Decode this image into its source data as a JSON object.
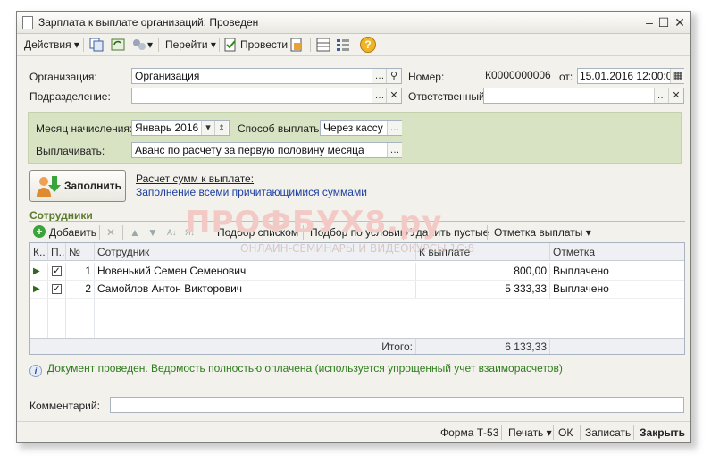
{
  "window": {
    "title": "Зарплата к выплате организаций: Проведен"
  },
  "toolbar": {
    "actions_label": "Действия",
    "goto_label": "Перейти",
    "post_label": "Провести",
    "help_icon": "?"
  },
  "form": {
    "org_label": "Организация:",
    "org_value": "Организация",
    "dept_label": "Подразделение:",
    "dept_value": "",
    "number_label": "Номер:",
    "number_value": "К0000000006",
    "from_label": "от:",
    "date_value": "15.01.2016 12:00:00",
    "responsible_label": "Ответственный:",
    "responsible_value": "",
    "month_label": "Месяц начисления:",
    "month_value": "Январь 2016",
    "pay_method_label": "Способ выплаты:",
    "pay_method_value": "Через кассу",
    "pay_label": "Выплачивать:",
    "pay_value": "Аванс по расчету за первую половину месяца"
  },
  "fill": {
    "button_label": "Заполнить",
    "link_calc": "Расчет сумм к выплате:",
    "link_fill": "Заполнение всеми причитающимися суммами"
  },
  "employees": {
    "section_title": "Сотрудники",
    "add_label": "Добавить",
    "pick_list": "Подбор списком",
    "pick_condition": "Подбор по условию",
    "delete_empty": "Удалить пустые",
    "mark_payment": "Отметка выплаты",
    "columns": [
      "К..",
      "П..",
      "№",
      "Сотрудник",
      "К выплате",
      "Отметка"
    ],
    "rows": [
      {
        "num": "1",
        "name": "Новенький Семен Семенович",
        "amount": "800,00",
        "mark": "Выплачено",
        "checked": "✓"
      },
      {
        "num": "2",
        "name": "Самойлов Антон Викторович",
        "amount": "5 333,33",
        "mark": "Выплачено",
        "checked": "✓"
      }
    ],
    "total_label": "Итого:",
    "total_value": "6 133,33"
  },
  "status_text": "Документ проведен. Ведомость полностью оплачена (используется упрощенный учет взаиморасчетов)",
  "comment_label": "Комментарий:",
  "comment_value": "",
  "bottom": {
    "form_t53": "Форма Т-53",
    "print": "Печать",
    "ok": "ОК",
    "save": "Записать",
    "close": "Закрыть"
  },
  "watermark": {
    "main": "ПРОФБУХ8.ру",
    "sub": "ОНЛАЙН-СЕМИНАРЫ И ВИДЕОКУРСЫ 1С:8"
  },
  "colors": {
    "accent_green": "#5c7a2b",
    "status_green": "#2e7d1f",
    "link_blue": "#1c3fa0",
    "panel_green": "#d8e3c3"
  }
}
